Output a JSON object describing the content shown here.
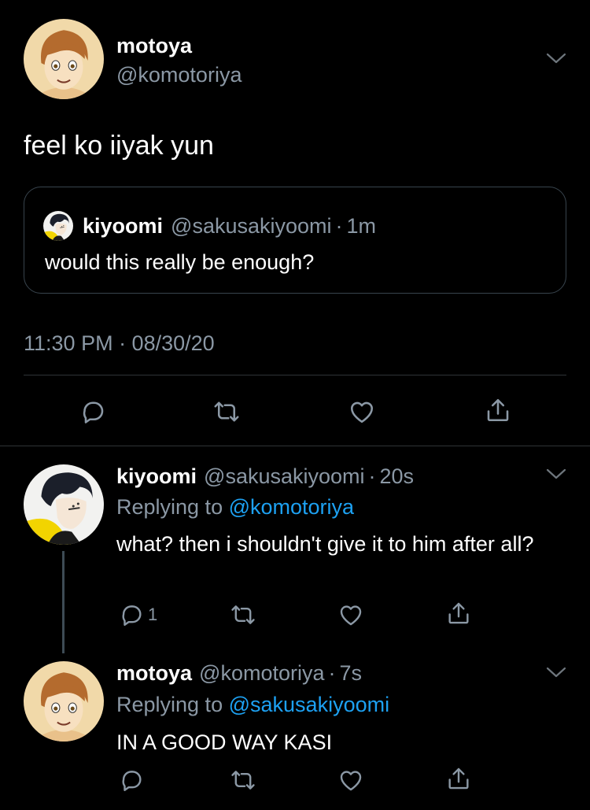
{
  "main_tweet": {
    "display_name": "motoya",
    "handle": "@komotoriya",
    "text": "feel ko iiyak yun",
    "quoted": {
      "display_name": "kiyoomi",
      "handle": "@sakusakiyoomi",
      "separator": "·",
      "time": "1m",
      "text": "would this really be enough?"
    },
    "timestamp": "11:30 PM · 08/30/20"
  },
  "replies": [
    {
      "display_name": "kiyoomi",
      "handle": "@sakusakiyoomi",
      "separator": "·",
      "time": "20s",
      "replying_prefix": "Replying to",
      "replying_to": "@komotoriya",
      "text": "what? then i shouldn't give it to him after all?",
      "reply_count": "1"
    },
    {
      "display_name": "motoya",
      "handle": "@komotoriya",
      "separator": "·",
      "time": "7s",
      "replying_prefix": "Replying to",
      "replying_to": "@sakusakiyoomi",
      "text": "IN A GOOD WAY KASI",
      "reply_count": ""
    }
  ],
  "icons": {
    "reply": "reply-icon",
    "retweet": "retweet-icon",
    "like": "heart-icon",
    "share": "share-icon",
    "more": "chevron-down-icon"
  },
  "colors": {
    "background": "#000000",
    "muted": "#8b98a5",
    "link": "#1da1f2",
    "border": "#38444d"
  }
}
